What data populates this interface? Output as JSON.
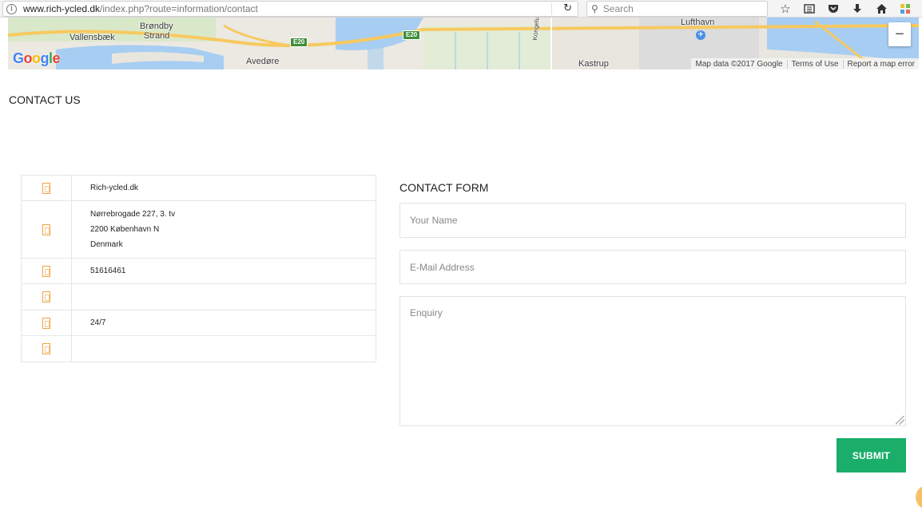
{
  "browser": {
    "url_host": "www.rich-ycled.dk",
    "url_path": "/index.php?route=information/contact",
    "search_placeholder": "Search",
    "icons": [
      "star-icon",
      "reading-list-icon",
      "pocket-icon",
      "download-icon",
      "home-icon",
      "extension-icon"
    ]
  },
  "map": {
    "labels": {
      "brondby": "Brøndby",
      "strand": "Strand",
      "vallensbaek": "Vallensbæk",
      "avedore": "Avedøre",
      "kastrup": "Kastrup",
      "lufthavn": "Lufthavn",
      "kongelunds": "Kongelunds"
    },
    "road_e20_a": "E20",
    "road_e20_b": "E20",
    "logo": [
      "G",
      "o",
      "o",
      "g",
      "l",
      "e"
    ],
    "footer": {
      "data": "Map data ©2017 Google",
      "terms": "Terms of Use",
      "report": "Report a map error"
    },
    "zoom_out": "−"
  },
  "page": {
    "title": "CONTACT US"
  },
  "contact_info": {
    "store": "Rich-ycled.dk",
    "address_line1": "Nørrebrogade 227, 3. tv",
    "address_line2": "2200 København N",
    "address_line3": "Denmark",
    "telephone": "51616461",
    "fax": "",
    "open": "24/7",
    "comment": ""
  },
  "form": {
    "title": "CONTACT FORM",
    "name_placeholder": "Your Name",
    "email_placeholder": "E-Mail Address",
    "enquiry_placeholder": "Enquiry",
    "submit_label": "SUBMIT"
  },
  "colors": {
    "accent": "#1aae6a",
    "icon_orange": "#f0a347"
  }
}
